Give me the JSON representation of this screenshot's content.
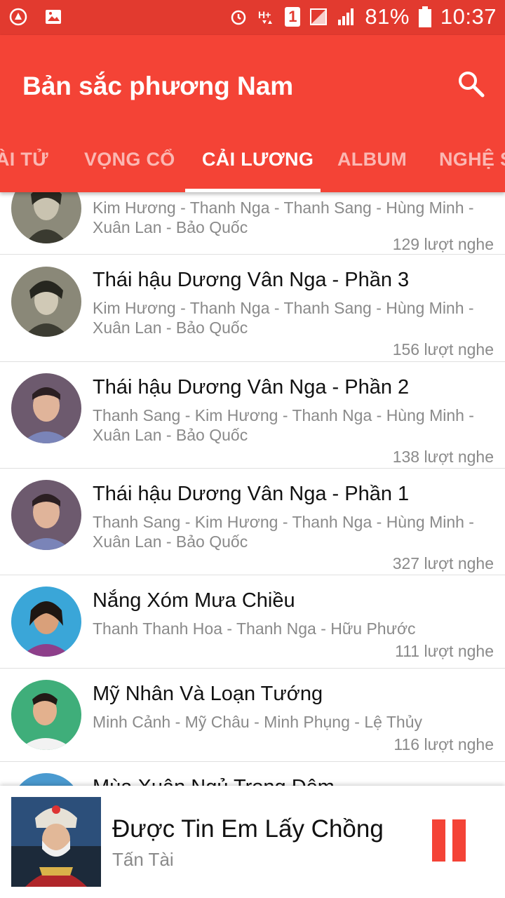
{
  "status_bar": {
    "battery": "81%",
    "time": "10:37",
    "sim_slot": "1",
    "icons": [
      "app-notification-icon",
      "image-notification-icon",
      "alarm-icon",
      "hplus-data-icon",
      "sim-icon",
      "signal-icon",
      "signal-icon",
      "battery-icon"
    ]
  },
  "app_bar": {
    "title": "Bản sắc phương Nam",
    "search_icon": "search-icon",
    "tabs": [
      {
        "label": "ÀI TỬ"
      },
      {
        "label": "VỌNG CỔ"
      },
      {
        "label": "CẢI LƯƠNG",
        "active": true
      },
      {
        "label": "ALBUM"
      },
      {
        "label": "NGHỆ S"
      }
    ]
  },
  "list": {
    "items": [
      {
        "title": "",
        "artists": "Kim Hương - Thanh Nga - Thanh Sang - Hùng Minh - Xuân Lan - Bảo Quốc",
        "plays": "129 lượt nghe"
      },
      {
        "title": "Thái hậu Dương Vân Nga - Phần 3",
        "artists": "Kim Hương - Thanh Nga - Thanh Sang - Hùng Minh - Xuân Lan - Bảo Quốc",
        "plays": "156 lượt nghe"
      },
      {
        "title": "Thái hậu Dương Vân Nga - Phần 2",
        "artists": "Thanh Sang - Kim Hương - Thanh Nga - Hùng Minh - Xuân Lan - Bảo Quốc",
        "plays": "138 lượt nghe"
      },
      {
        "title": "Thái hậu Dương Vân Nga - Phần 1",
        "artists": "Thanh Sang - Kim Hương - Thanh Nga - Hùng Minh - Xuân Lan - Bảo Quốc",
        "plays": "327 lượt nghe"
      },
      {
        "title": "Nắng Xóm Mưa Chiều",
        "artists": "Thanh Thanh Hoa - Thanh Nga - Hữu Phước",
        "plays": "111 lượt nghe"
      },
      {
        "title": "Mỹ Nhân Và Loạn Tướng",
        "artists": "Minh Cảnh - Mỹ Châu - Minh Phụng - Lệ Thủy",
        "plays": "116 lượt nghe"
      },
      {
        "title": "Mùa Xuân Ngủ Trong Đêm",
        "artists": "",
        "plays": ""
      }
    ]
  },
  "player": {
    "title": "Được Tin Em Lấy Chồng",
    "artist": "Tấn Tài",
    "pause_icon": "pause-icon"
  },
  "colors": {
    "accent": "#f44336",
    "status_bar": "#e23a2f",
    "secondary_text": "#8a8a8a"
  }
}
